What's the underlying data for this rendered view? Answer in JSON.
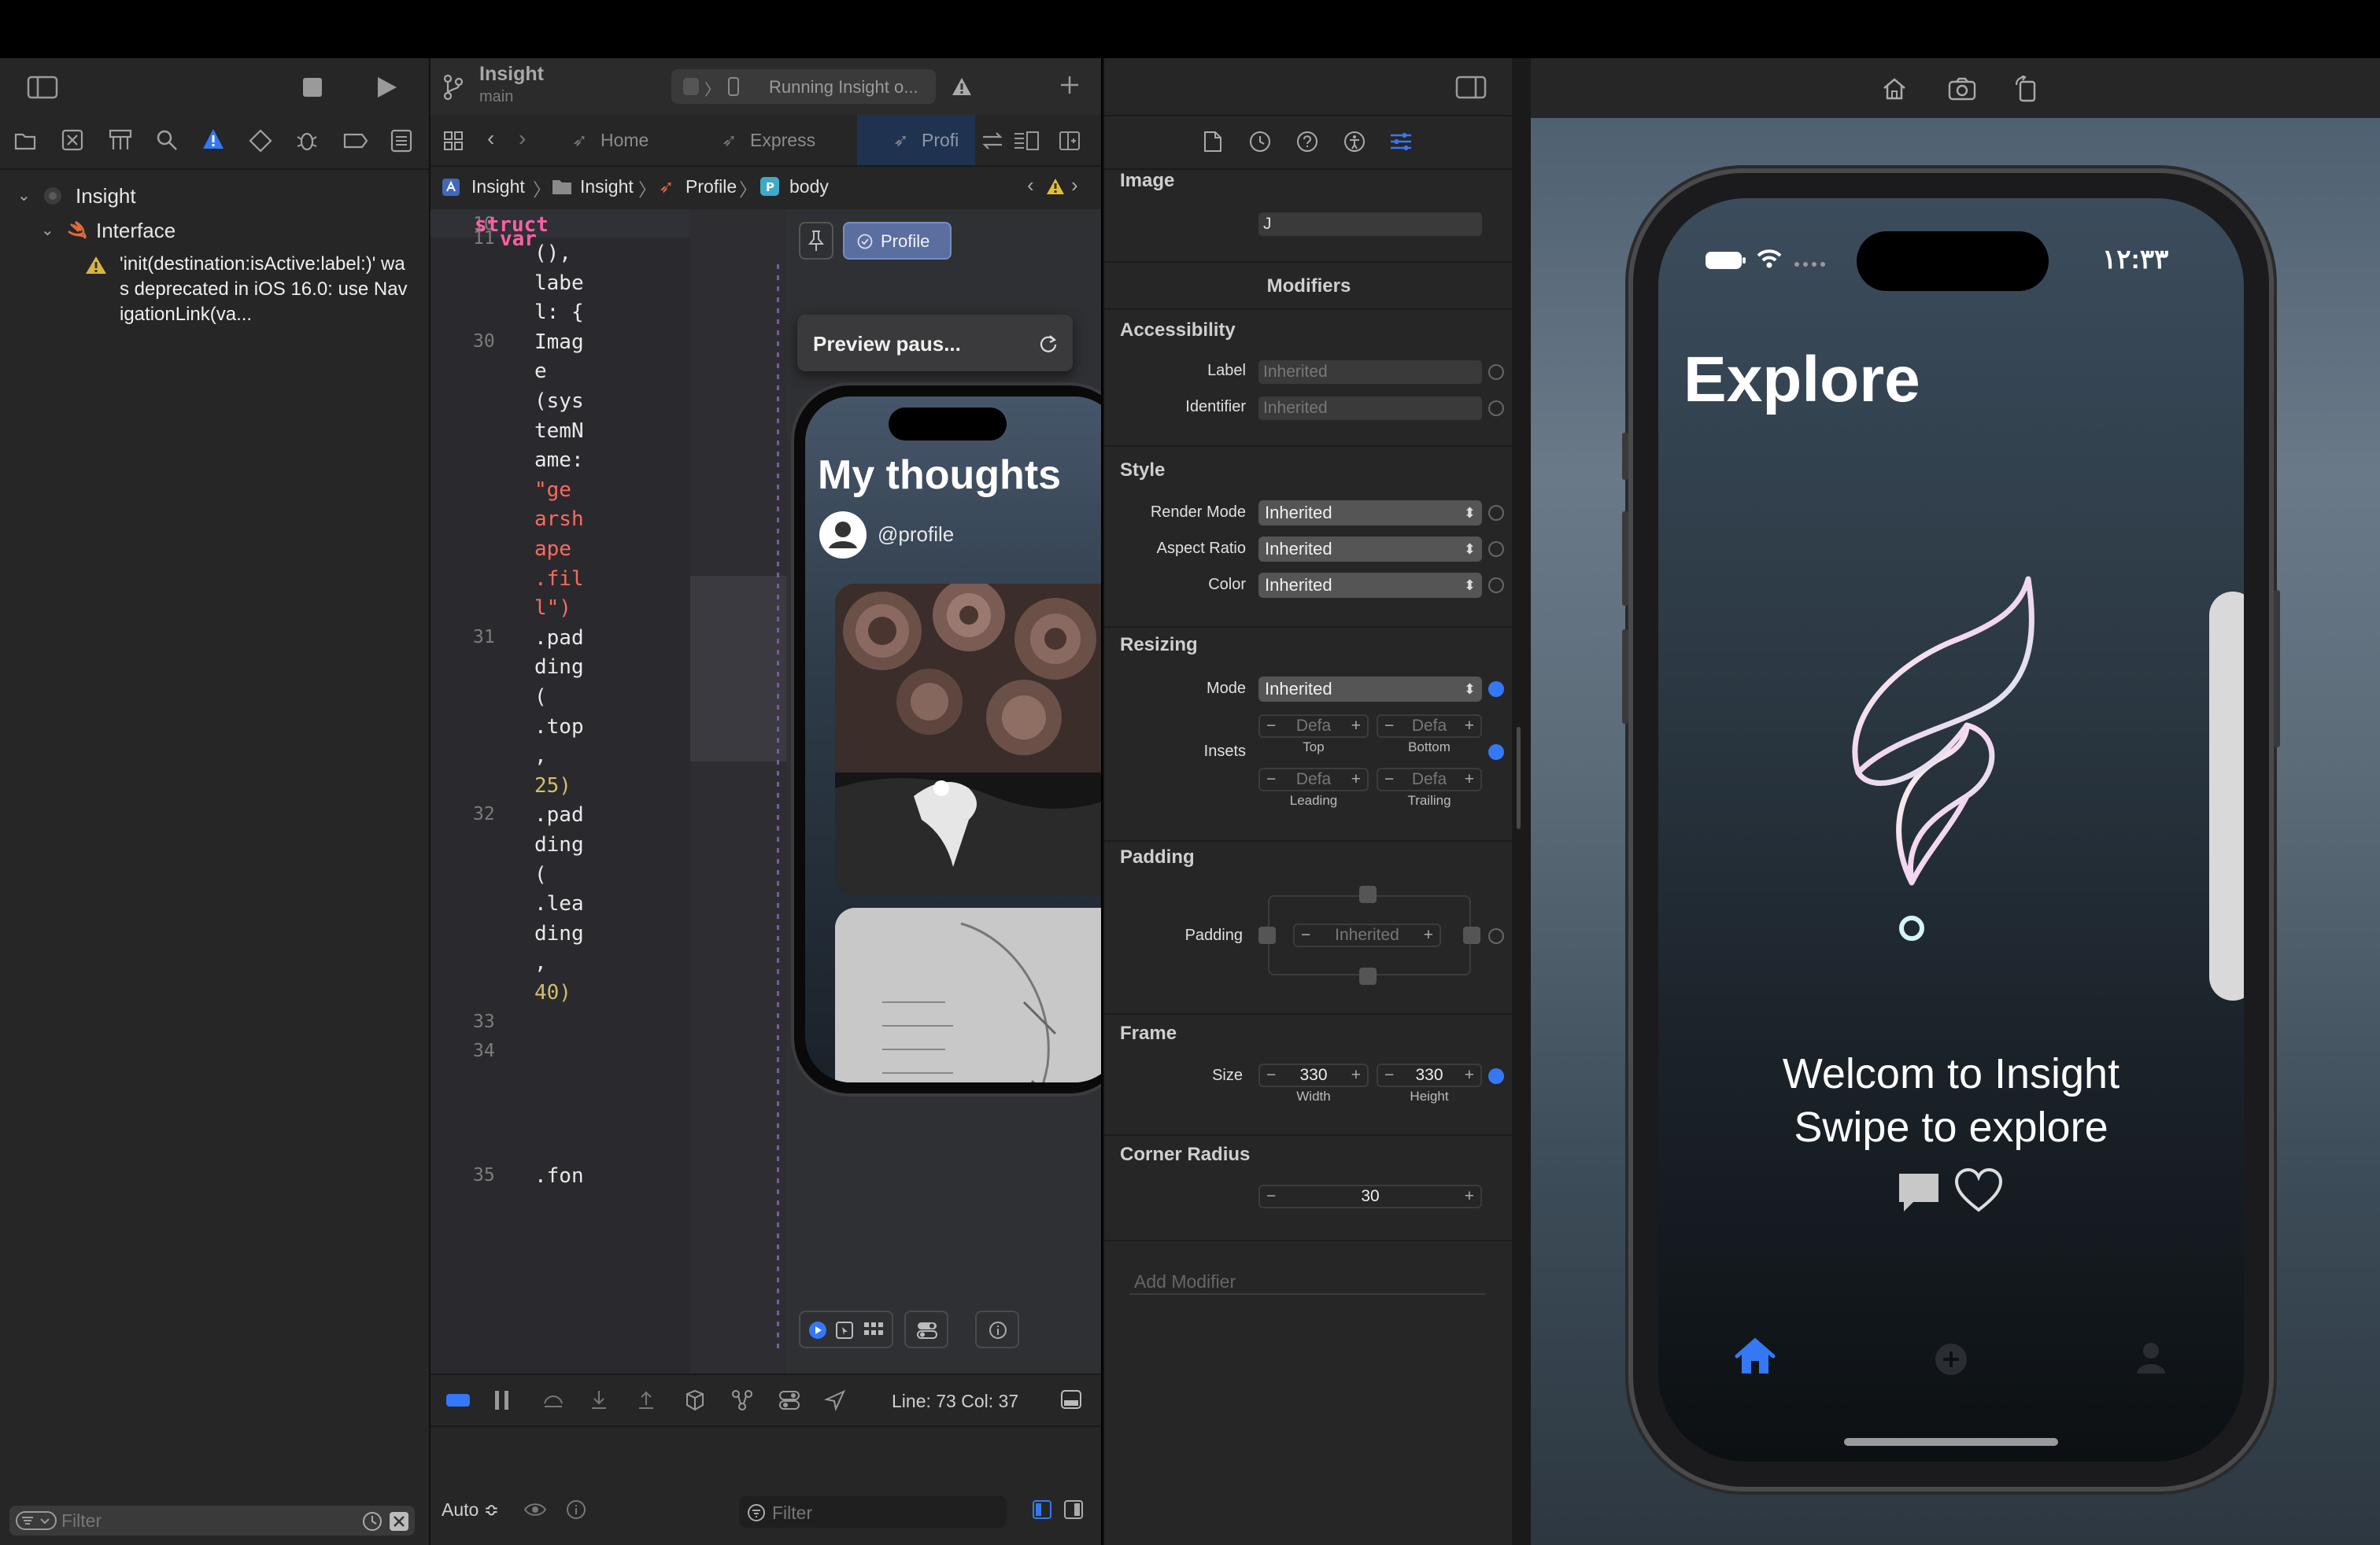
{
  "navigator": {
    "filter_placeholder": "Filter",
    "tree": {
      "project": "Insight",
      "group": "Interface",
      "warning": "'init(destination:isActive:label:)' was deprecated in iOS 16.0: use NavigationLink(va..."
    }
  },
  "editor": {
    "scheme": {
      "name": "Insight",
      "branch": "main"
    },
    "status": "Running Insight o...",
    "tabs": [
      "Home",
      "Express",
      "Profi"
    ],
    "jumpbar": [
      "Insight",
      "Insight",
      "Profile",
      "body"
    ],
    "code": {
      "line_numbers": [
        "10",
        "11",
        "30",
        "31",
        "32",
        "33",
        "34",
        "35"
      ],
      "lines": [
        {
          "ln": "10",
          "text": "struct",
          "kind": "keyword"
        },
        {
          "ln": "11",
          "text": "var",
          "kind": "keyword"
        },
        {
          "ln": "",
          "text": "(),",
          "kind": "plain"
        },
        {
          "ln": "",
          "text": "labe",
          "kind": "plain"
        },
        {
          "ln": "",
          "text": "l: {",
          "kind": "plain"
        },
        {
          "ln": "30",
          "text": "Imag",
          "kind": "plain"
        },
        {
          "ln": "",
          "text": "e",
          "kind": "plain"
        },
        {
          "ln": "",
          "text": "(sys",
          "kind": "plain"
        },
        {
          "ln": "",
          "text": "temN",
          "kind": "plain"
        },
        {
          "ln": "",
          "text": "ame:",
          "kind": "plain"
        },
        {
          "ln": "",
          "text": "\"ge",
          "kind": "string"
        },
        {
          "ln": "",
          "text": "arsh",
          "kind": "string"
        },
        {
          "ln": "",
          "text": "ape",
          "kind": "string"
        },
        {
          "ln": "",
          "text": ".fil",
          "kind": "string"
        },
        {
          "ln": "",
          "text": "l\")",
          "kind": "string"
        },
        {
          "ln": "31",
          "text": ".pad",
          "kind": "plain"
        },
        {
          "ln": "",
          "text": "ding",
          "kind": "plain"
        },
        {
          "ln": "",
          "text": "(",
          "kind": "plain"
        },
        {
          "ln": "",
          "text": ".top",
          "kind": "plain"
        },
        {
          "ln": "",
          "text": ",",
          "kind": "plain"
        },
        {
          "ln": "",
          "text": "25)",
          "kind": "number"
        },
        {
          "ln": "32",
          "text": ".pad",
          "kind": "plain"
        },
        {
          "ln": "",
          "text": "ding",
          "kind": "plain"
        },
        {
          "ln": "",
          "text": "(",
          "kind": "plain"
        },
        {
          "ln": "",
          "text": ".lea",
          "kind": "plain"
        },
        {
          "ln": "",
          "text": "ding",
          "kind": "plain"
        },
        {
          "ln": "",
          "text": ",",
          "kind": "plain"
        },
        {
          "ln": "",
          "text": "40)",
          "kind": "number"
        },
        {
          "ln": "33",
          "text": "",
          "kind": "plain"
        },
        {
          "ln": "34",
          "text": "",
          "kind": "plain"
        },
        {
          "ln": "35",
          "text": ".fon",
          "kind": "plain"
        }
      ]
    },
    "preview": {
      "pin_label": "Profile",
      "paused_label": "Preview paus...",
      "phone_title": "My thoughts",
      "handle": "@profile"
    },
    "debug": {
      "position": "Line: 73  Col: 37"
    },
    "bottom": {
      "mode": "Auto ≎",
      "filter_placeholder": "Filter"
    }
  },
  "inspector": {
    "image_section": "Image",
    "image_value": "J",
    "modifiers_title": "Modifiers",
    "accessibility": {
      "title": "Accessibility",
      "label_label": "Label",
      "label_value": "Inherited",
      "identifier_label": "Identifier",
      "identifier_value": "Inherited"
    },
    "style": {
      "title": "Style",
      "render_mode_label": "Render Mode",
      "render_mode": "Inherited",
      "aspect_label": "Aspect Ratio",
      "aspect": "Inherited",
      "color_label": "Color",
      "color": "Inherited"
    },
    "resizing": {
      "title": "Resizing",
      "mode_label": "Mode",
      "mode": "Inherited",
      "insets_label": "Insets",
      "inset_value": "Defa",
      "top": "Top",
      "bottom": "Bottom",
      "leading": "Leading",
      "trailing": "Trailing"
    },
    "padding": {
      "title": "Padding",
      "label": "Padding",
      "value": "Inherited"
    },
    "frame": {
      "title": "Frame",
      "size_label": "Size",
      "width": "330",
      "height": "330",
      "width_label": "Width",
      "height_label": "Height"
    },
    "corner": {
      "title": "Corner Radius",
      "value": "30"
    },
    "add_modifier_placeholder": "Add Modifier"
  },
  "simulator": {
    "time": "۱۲:۳۳",
    "title": "Explore",
    "welcome": "Welcom to Insight",
    "swipe": "Swipe to explore"
  },
  "colors": {
    "accent": "#3478f6",
    "keyword": "#fc5fa3",
    "string": "#fc6a5d",
    "number": "#d0bf69"
  }
}
